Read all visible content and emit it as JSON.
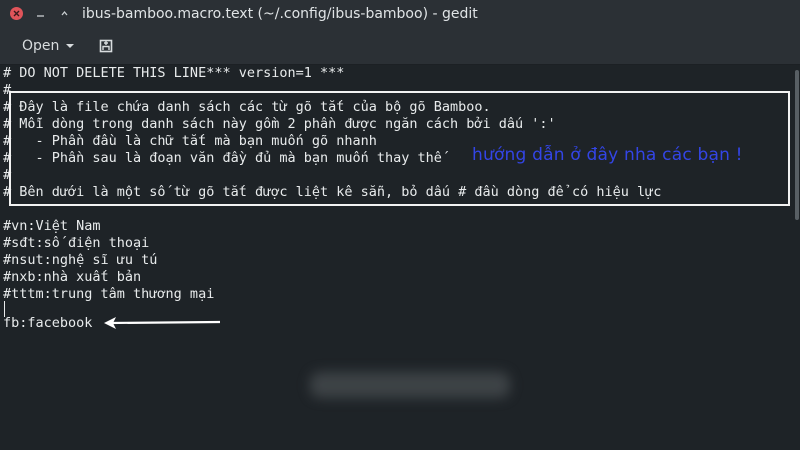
{
  "window": {
    "title": "ibus-bamboo.macro.text (~/.config/ibus-bamboo) - gedit"
  },
  "toolbar": {
    "open_label": "Open"
  },
  "editor": {
    "lines": [
      "# DO NOT DELETE THIS LINE*** version=1 ***",
      "#",
      "# Đây là file chứa danh sách các từ gõ tắt của bộ gõ Bamboo.",
      "# Mỗi dòng trong danh sách này gồm 2 phần được ngăn cách bởi dấu ':'",
      "#   - Phần đầu là chữ tắt mà bạn muốn gõ nhanh",
      "#   - Phần sau là đoạn văn đầy đủ mà bạn muốn thay thế",
      "#",
      "# Bên dưới là một số từ gõ tắt được liệt kê sẵn, bỏ dấu # đầu dòng để có hiệu lực",
      "",
      "#vn:Việt Nam",
      "#sđt:số điện thoại",
      "#nsut:nghệ sĩ ưu tú",
      "#nxb:nhà xuất bản",
      "#tttm:trung tâm thương mại",
      "",
      "fb:facebook"
    ],
    "annotation": "hướng dẫn ở đây nha các bạn !"
  },
  "colors": {
    "background": "#1e2327",
    "annotation": "#3345e6",
    "close_button": "#e0545a"
  }
}
